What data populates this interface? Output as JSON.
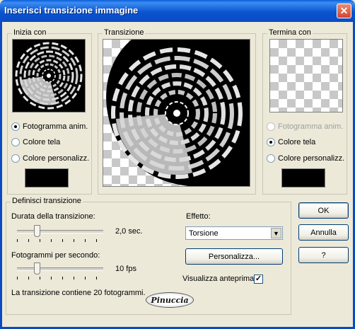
{
  "window": {
    "title": "Inserisci transizione immagine",
    "close_glyph": "✕"
  },
  "start_group": {
    "label": "Inizia con",
    "options": [
      "Fotogramma anim.",
      "Colore tela",
      "Colore personalizz."
    ],
    "selected": 0,
    "swatch_color": "#000000"
  },
  "transition_group": {
    "label": "Transizione"
  },
  "end_group": {
    "label": "Termina con",
    "options": [
      "Fotogramma anim.",
      "Colore tela",
      "Colore personalizz."
    ],
    "selected": 1,
    "disabled": [
      0
    ],
    "swatch_color": "#000000"
  },
  "define_group": {
    "label": "Definisci transizione",
    "duration_label": "Durata della transizione:",
    "duration_value": "2,0 sec.",
    "fps_label": "Fotogrammi per secondo:",
    "fps_value": "10 fps",
    "info": "La transizione contiene 20 fotogrammi.",
    "effect_label": "Effetto:",
    "effect_value": "Torsione",
    "customize_label": "Personalizza...",
    "preview_label": "Visualizza anteprima",
    "preview_checked": true
  },
  "buttons": {
    "ok": "OK",
    "cancel": "Annulla",
    "help": "?"
  },
  "logo": {
    "text": "Pinuccia"
  }
}
